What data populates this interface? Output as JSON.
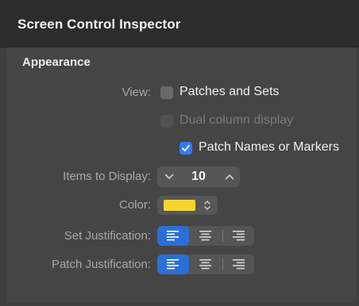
{
  "window": {
    "title": "Screen Control Inspector"
  },
  "appearance": {
    "header": "Appearance",
    "view_label": "View:",
    "patches_and_sets": {
      "label": "Patches and Sets",
      "checked": false
    },
    "dual_column": {
      "label": "Dual column display",
      "checked": false,
      "enabled": false
    },
    "patch_names_or_markers": {
      "label": "Patch Names or Markers",
      "checked": true
    },
    "items_to_display": {
      "label": "Items to Display:",
      "value": "10"
    },
    "color": {
      "label": "Color:",
      "value": "#f7d52f"
    },
    "set_justification": {
      "label": "Set Justification:",
      "options": [
        "left-align-icon",
        "center-align-icon",
        "right-align-icon"
      ],
      "selected": "left"
    },
    "patch_justification": {
      "label": "Patch Justification:",
      "options": [
        "left-align-icon",
        "center-align-icon",
        "right-align-icon"
      ],
      "selected": "left"
    }
  },
  "colors": {
    "accent": "#2f7cf6",
    "selected_segment": "#2b6fd6",
    "panel": "#454545",
    "title_bar": "#2c2c2c"
  }
}
